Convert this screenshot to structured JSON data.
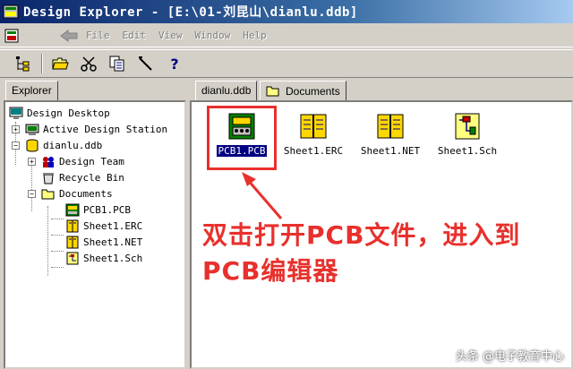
{
  "window": {
    "title": "Design Explorer - [E:\\01-刘昆山\\dianlu.ddb]"
  },
  "menu": {
    "items": [
      "File",
      "Edit",
      "View",
      "Window",
      "Help"
    ]
  },
  "toolbar": {
    "buttons": [
      "tree-toggle-icon",
      "open-folder-icon",
      "cut-icon",
      "copy-icon",
      "paste-icon",
      "help-icon"
    ]
  },
  "explorer": {
    "tab_label": "Explorer",
    "tree": {
      "design_desktop": "Design Desktop",
      "active_design_station": "Active Design Station",
      "dianlu_ddb": "dianlu.ddb",
      "design_team": "Design Team",
      "recycle_bin": "Recycle Bin",
      "documents": "Documents",
      "docs": [
        "PCB1.PCB",
        "Sheet1.ERC",
        "Sheet1.NET",
        "Sheet1.Sch"
      ]
    }
  },
  "content": {
    "tab_ddb": "dianlu.ddb",
    "tab_documents": "Documents",
    "files": [
      "PCB1.PCB",
      "Sheet1.ERC",
      "Sheet1.NET",
      "Sheet1.Sch"
    ]
  },
  "annotation": {
    "line1": "双击打开PCB文件，进入到",
    "line2": "PCB编辑器"
  },
  "watermark": "头条 @电子教育中心",
  "colors": {
    "title_start": "#0a246a",
    "title_end": "#a6caf0",
    "annotation_red": "#e8302c",
    "highlight_bg": "#000080"
  }
}
